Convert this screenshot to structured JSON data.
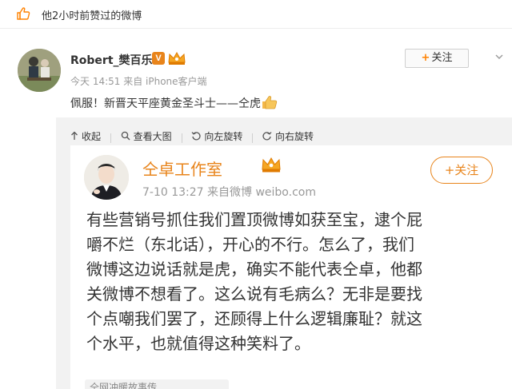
{
  "topbar": {
    "liked_text": "他2小时前赞过的微博"
  },
  "post": {
    "author": "Robert_樊百乐",
    "v_badge": "V",
    "meta": "今天 14:51 来自 iPhone客户端",
    "follow_label": "关注",
    "content": "佩服！新晋天平座黄金圣斗士——仝虎",
    "actions": {
      "collapse": "收起",
      "view_large": "查看大图",
      "rotate_left": "向左旋转",
      "rotate_right": "向右旋转"
    }
  },
  "screenshot": {
    "name": "仝卓工作室",
    "meta": "7-10 13:27  来自微博 weibo.com",
    "follow_label": "关注",
    "text_lines": [
      "有些营销号抓住我们置顶微博如获至宝，逮个屁",
      "嚼不烂（东北话），开心的不行。怎么了，我们",
      "微博这边说话就是虎，确实不能代表仝卓，他都",
      "关微博不想看了。这么说有毛病么？无非是要找",
      "个点嘲我们罢了，还顾得上什么逻辑廉耻？就这",
      "个水平，也就值得这种笑料了。"
    ],
    "footer": "仝网冲暖故事传"
  },
  "colors": {
    "accent": "#ff8200",
    "orange_name": "#e8841b",
    "meta_gray": "#999999"
  }
}
